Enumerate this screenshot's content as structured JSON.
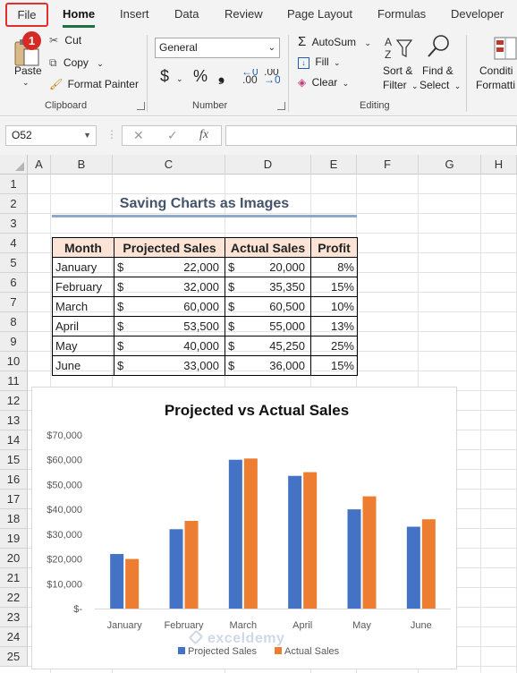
{
  "ribbon_tabs": [
    "File",
    "Home",
    "Insert",
    "Data",
    "Review",
    "Page Layout",
    "Formulas",
    "Developer"
  ],
  "badge": "1",
  "clipboard": {
    "paste": "Paste",
    "cut": "Cut",
    "copy": "Copy",
    "format_painter": "Format Painter",
    "group": "Clipboard"
  },
  "number": {
    "format": "General",
    "group": "Number"
  },
  "editing": {
    "autosum": "AutoSum",
    "fill": "Fill",
    "clear": "Clear",
    "sort_filter_1": "Sort &",
    "sort_filter_2": "Filter",
    "find_select_1": "Find &",
    "find_select_2": "Select",
    "group": "Editing"
  },
  "conditional": {
    "line1": "Conditi",
    "line2": "Formatti"
  },
  "name_box": "O52",
  "formula_value": "",
  "columns": [
    "A",
    "B",
    "C",
    "D",
    "E",
    "F",
    "G",
    "H"
  ],
  "rows": [
    "1",
    "2",
    "3",
    "4",
    "5",
    "6",
    "7",
    "8",
    "9",
    "10",
    "11",
    "12",
    "13",
    "14",
    "15",
    "16",
    "17",
    "18",
    "19",
    "20",
    "21",
    "22",
    "23",
    "24",
    "25"
  ],
  "sheet_title": "Saving Charts as Images",
  "table": {
    "headers": [
      "Month",
      "Projected Sales",
      "Actual Sales",
      "Profit"
    ],
    "rows": [
      {
        "month": "January",
        "cur1": "$",
        "projected": "22,000",
        "cur2": "$",
        "actual": "20,000",
        "profit": "8%"
      },
      {
        "month": "February",
        "cur1": "$",
        "projected": "32,000",
        "cur2": "$",
        "actual": "35,350",
        "profit": "15%"
      },
      {
        "month": "March",
        "cur1": "$",
        "projected": "60,000",
        "cur2": "$",
        "actual": "60,500",
        "profit": "10%"
      },
      {
        "month": "April",
        "cur1": "$",
        "projected": "53,500",
        "cur2": "$",
        "actual": "55,000",
        "profit": "13%"
      },
      {
        "month": "May",
        "cur1": "$",
        "projected": "40,000",
        "cur2": "$",
        "actual": "45,250",
        "profit": "25%"
      },
      {
        "month": "June",
        "cur1": "$",
        "projected": "33,000",
        "cur2": "$",
        "actual": "36,000",
        "profit": "15%"
      }
    ]
  },
  "chart_data": {
    "type": "bar",
    "title": "Projected vs Actual Sales",
    "categories": [
      "January",
      "February",
      "March",
      "April",
      "May",
      "June"
    ],
    "series": [
      {
        "name": "Projected Sales",
        "values": [
          22000,
          32000,
          60000,
          53500,
          40000,
          33000
        ],
        "color": "#4472c4"
      },
      {
        "name": "Actual Sales",
        "values": [
          20000,
          35350,
          60500,
          55000,
          45250,
          36000
        ],
        "color": "#ed7d31"
      }
    ],
    "ylim": [
      0,
      70000
    ],
    "y_ticks": [
      "$-",
      "$10,000",
      "$20,000",
      "$30,000",
      "$40,000",
      "$50,000",
      "$60,000",
      "$70,000"
    ],
    "grid": false,
    "legend": "bottom"
  },
  "watermark": "exceldemy"
}
